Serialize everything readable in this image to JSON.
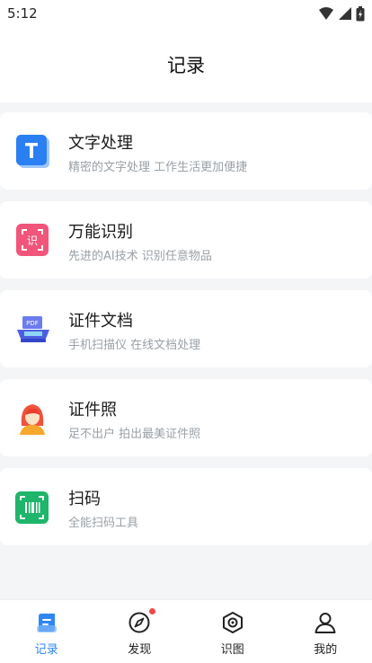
{
  "status_bar": {
    "time": "5:12"
  },
  "header": {
    "title": "记录"
  },
  "items": [
    {
      "name": "文字处理",
      "desc": "精密的文字处理 工作生活更加便捷",
      "icon": "text-t-icon"
    },
    {
      "name": "万能识别",
      "desc": "先进的AI技术 识别任意物品",
      "icon": "scan-recognize-icon"
    },
    {
      "name": "证件文档",
      "desc": "手机扫描仪 在线文档处理",
      "icon": "pdf-scanner-icon"
    },
    {
      "name": "证件照",
      "desc": "足不出户 拍出最美证件照",
      "icon": "portrait-icon"
    },
    {
      "name": "扫码",
      "desc": "全能扫码工具",
      "icon": "barcode-scan-icon"
    }
  ],
  "tabs": [
    {
      "label": "记录",
      "icon": "record-doc-icon",
      "active": true
    },
    {
      "label": "发现",
      "icon": "compass-icon",
      "badge": true
    },
    {
      "label": "识图",
      "icon": "lens-icon"
    },
    {
      "label": "我的",
      "icon": "profile-icon"
    }
  ],
  "colors": {
    "accent": "#2e86f5",
    "badge": "#f04b4b",
    "page_bg": "#f4f5f7"
  }
}
